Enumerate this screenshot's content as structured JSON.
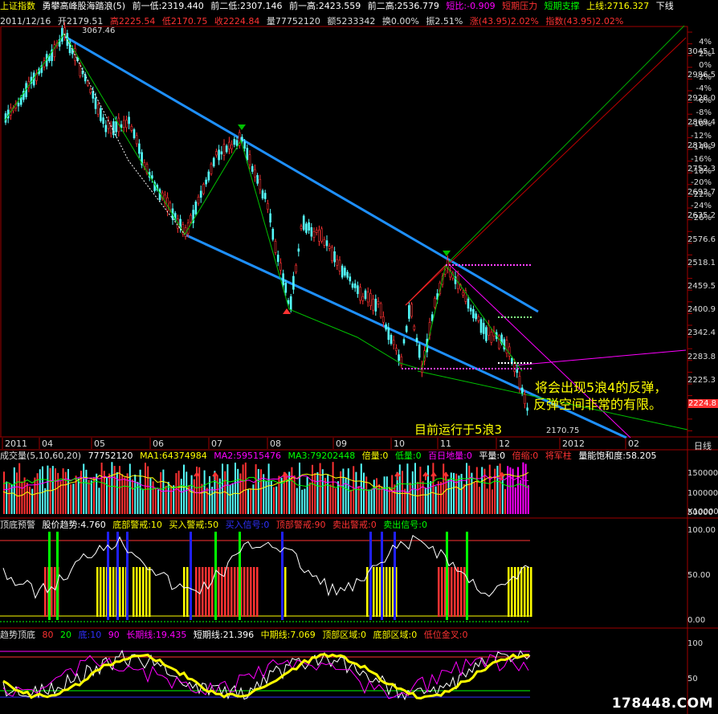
{
  "header": {
    "index_name": "上证指数",
    "indicator_name": "勇攀高峰股海踏浪(5)",
    "prev_low1": "前一低:2319.440",
    "prev_low2": "前二低:2307.146",
    "prev_high1": "前一高:2423.559",
    "prev_high2": "前二高:2536.779",
    "short_ratio": "短比:-0.909",
    "short_pressure": "短期压力",
    "short_support": "短期支撑",
    "upper_line": "上线:2716.327",
    "lower_line": "下线"
  },
  "quote": {
    "date": "2011/12/16",
    "open": "开2179.51",
    "high": "高2225.54",
    "low": "低2170.75",
    "close": "收2224.84",
    "volume": "量77752120",
    "amount": "额5233342",
    "turnover": "换0.00%",
    "amplitude": "振2.51%",
    "change": "涨(43.95)2.02%",
    "index_change": "指数(43.95)2.02%"
  },
  "price_axis": {
    "labels": [
      "3045.1",
      "2986.5",
      "2928.0",
      "2869.4",
      "2810.9",
      "2752.3",
      "2693.7",
      "2635.2",
      "2576.6",
      "2518.1",
      "2459.5",
      "2400.9",
      "2342.4",
      "2283.8",
      "2225.3"
    ],
    "pct_labels": [
      "4%",
      "2%",
      "0%",
      "-2%",
      "-4%",
      "-6%",
      "-8%",
      "-10%",
      "-12%",
      "-14%",
      "-16%",
      "-18%",
      "-20%",
      "-22%",
      "-24%",
      "-26%"
    ],
    "current_price": "2224.8"
  },
  "annotations": {
    "high_mark": "3067.46",
    "low_mark": "2170.75",
    "forecast_line1": "将会出现5浪4的反弹，",
    "forecast_line2": "反弹空间非常的有限。",
    "current_wave": "目前运行于5浪3"
  },
  "time_axis": {
    "labels": [
      "2011",
      "04",
      "05",
      "06",
      "07",
      "08",
      "09",
      "10",
      "11",
      "12",
      "2012",
      "02"
    ],
    "period": "日线"
  },
  "volume_panel": {
    "title": "成交量(5,10,60,20)",
    "value": "77752120",
    "ma1": "MA1:64374984",
    "ma2": "MA2:59515476",
    "ma3": "MA3:79202448",
    "double_vol": "倍量:0",
    "low_vol": "低量:0",
    "hundred_day_low": "百日地量:0",
    "flat_vol": "平量:0",
    "shrink_vol": "倍缩:0",
    "general_pillar": "将军柱",
    "saturation": "量能饱和度:58.205",
    "axis": [
      "150000",
      "100000",
      "50000",
      "X10000"
    ]
  },
  "top_bottom_panel": {
    "title": "顶底预警",
    "trend": "股价趋势:4.760",
    "bottom_warn": "底部警戒:10",
    "buy_warn": "买入警戒:50",
    "buy_signal": "买入信号:0",
    "top_warn": "顶部警戒:90",
    "sell_warn": "卖出警戒:0",
    "sell_signal": "卖出信号:0",
    "axis": [
      "100.00",
      "50.00",
      "0.00"
    ]
  },
  "trend_panel": {
    "title": "趋势顶底",
    "v80": "80",
    "v20": "20",
    "bottom": "底:10",
    "v90": "90",
    "long_line": "长期线:19.435",
    "short_line": "短期线:21.396",
    "mid_line": "中期线:7.069",
    "top_zone": "顶部区域:0",
    "bottom_zone": "底部区域:0",
    "low_golden_cross": "低位金叉:0",
    "axis": [
      "100",
      "50"
    ]
  },
  "watermark": "178448.COM",
  "colors": {
    "up": "#ff3232",
    "down": "#54fcfc",
    "channel": "#1e90ff",
    "wave": "#00c000",
    "yellow": "#ffff00",
    "magenta": "#ff00ff"
  }
}
